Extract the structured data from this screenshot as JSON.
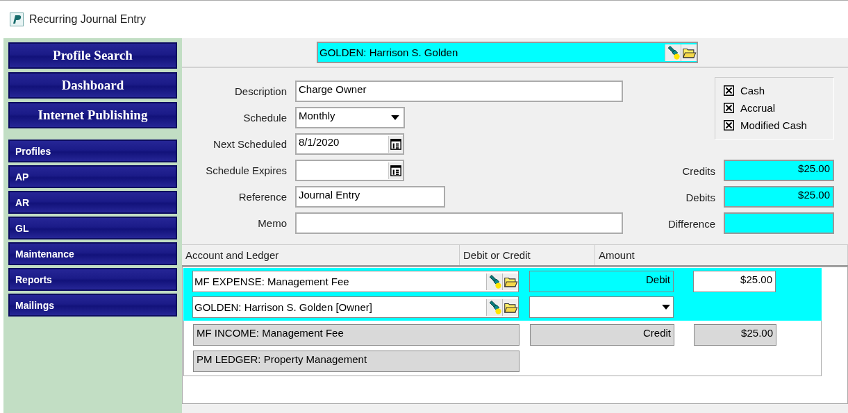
{
  "window": {
    "title": "Recurring Journal Entry"
  },
  "sidebar": {
    "main_buttons": [
      "Profile Search",
      "Dashboard",
      "Internet Publishing"
    ],
    "items": [
      "Profiles",
      "AP",
      "AR",
      "GL",
      "Maintenance",
      "Reports",
      "Mailings"
    ]
  },
  "profile_field": {
    "value": "GOLDEN: Harrison S. Golden"
  },
  "form": {
    "fields": [
      {
        "label": "Description",
        "kind": "text",
        "value": "Charge Owner"
      },
      {
        "label": "Schedule",
        "kind": "dropdown",
        "value": "Monthly"
      },
      {
        "label": "Next Scheduled",
        "kind": "date",
        "value": "8/1/2020"
      },
      {
        "label": "Schedule Expires",
        "kind": "date"
      },
      {
        "label": "Reference",
        "kind": "short",
        "value": "Journal Entry"
      },
      {
        "label": "Memo",
        "kind": "text"
      }
    ]
  },
  "basis": [
    {
      "label": "Cash",
      "checked": true
    },
    {
      "label": "Accrual",
      "checked": true
    },
    {
      "label": "Modified Cash",
      "checked": true
    }
  ],
  "totals": [
    {
      "label": "Credits",
      "value": "$25.00"
    },
    {
      "label": "Debits",
      "value": "$25.00"
    },
    {
      "label": "Difference"
    }
  ],
  "table": {
    "columns": [
      "Account and Ledger",
      "Debit or Credit",
      "Amount"
    ],
    "rows": [
      {
        "selected": true,
        "account": "MF EXPENSE: Management Fee",
        "ledger": "GOLDEN: Harrison S. Golden [Owner]",
        "type": "Debit",
        "amount": "$25.00"
      },
      {
        "selected": false,
        "account": "MF INCOME: Management Fee",
        "ledger": "PM LEDGER: Property Management",
        "type": "Credit",
        "amount": "$25.00"
      }
    ]
  }
}
